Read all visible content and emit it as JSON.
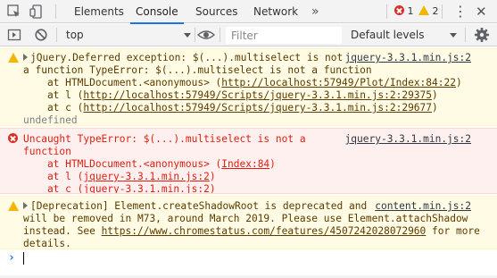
{
  "tabs": [
    "Elements",
    "Console",
    "Sources",
    "Network"
  ],
  "more_tabs": "»",
  "error_count": "1",
  "warning_count": "2",
  "menu_glyph": "⋮",
  "toolbar": {
    "context": "top",
    "filter_placeholder": "Filter",
    "levels": "Default levels"
  },
  "messages": [
    {
      "level": "warning",
      "lines": [
        "jQuery.Deferred exception: $(...).multiselect is not",
        "a function TypeError: $(...).multiselect is not a function",
        "    at HTMLDocument.<anonymous> (",
        "    at l (",
        "    at c ("
      ],
      "links": [
        "http://localhost:57949/Plot/Index:84:22",
        "http://localhost:57949/Scripts/jquery-3.3.1.min.js:2:29375",
        "http://localhost:57949/Scripts/jquery-3.3.1.min.js:2:29677"
      ],
      "source": "jquery-3.3.1.min.js:2",
      "result": "undefined"
    },
    {
      "level": "error",
      "lines": [
        "Uncaught TypeError: $(...).multiselect is not a",
        "function",
        "    at HTMLDocument.<anonymous> (",
        "    at l (",
        "    at c ("
      ],
      "links": [
        "Index:84",
        "jquery-3.3.1.min.js:2",
        "jquery-3.3.1.min.js:2"
      ],
      "source": "jquery-3.3.1.min.js:2"
    },
    {
      "level": "warning",
      "lines": [
        "[Deprecation] Element.createShadowRoot is deprecated and",
        "will be removed in M73, around March 2019. Please use Element.attachShadow",
        "instead. See ",
        " for more",
        "details."
      ],
      "links": [
        "https://www.chromestatus.com/features/4507242028072960"
      ],
      "source": "content.min.js:2"
    }
  ],
  "prompt_glyph": "›"
}
